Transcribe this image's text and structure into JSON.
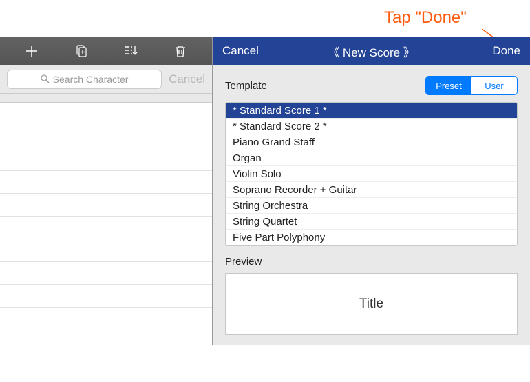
{
  "annotation": {
    "text": "Tap \"Done\""
  },
  "left": {
    "search_placeholder": "Search Character",
    "search_cancel": "Cancel"
  },
  "right": {
    "nav": {
      "cancel": "Cancel",
      "title": "《 New Score 》",
      "done": "Done"
    },
    "template": {
      "label": "Template",
      "seg_preset": "Preset",
      "seg_user": "User",
      "items": [
        "* Standard Score 1 *",
        "* Standard Score 2 *",
        "Piano Grand Staff",
        "Organ",
        "Violin Solo",
        "Soprano Recorder + Guitar",
        "String Orchestra",
        "String Quartet",
        "Five Part Polyphony"
      ],
      "selected_index": 0
    },
    "preview": {
      "label": "Preview",
      "title": "Title"
    }
  }
}
